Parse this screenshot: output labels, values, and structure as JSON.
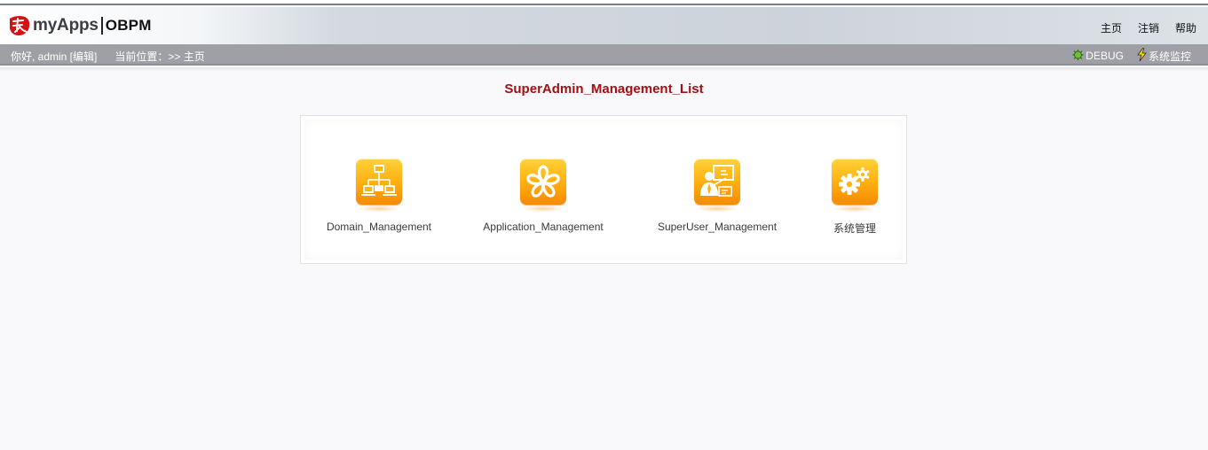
{
  "header": {
    "brand": "myApps",
    "product": "OBPM",
    "nav": [
      "主页",
      "注销",
      "帮助"
    ]
  },
  "bar": {
    "greeting": "你好, admin [编辑]",
    "location": "当前位置：>> 主页",
    "debug": "DEBUG",
    "monitor": "系统监控"
  },
  "main": {
    "title": "SuperAdmin_Management_List",
    "tiles": [
      {
        "label": "Domain_Management",
        "icon": "network-icon"
      },
      {
        "label": "Application_Management",
        "icon": "flower-icon"
      },
      {
        "label": "SuperUser_Management",
        "icon": "presenter-icon"
      },
      {
        "label": "系统管理",
        "icon": "gears-icon"
      }
    ]
  },
  "colors": {
    "title": "#a30f12",
    "bar": "#9ea0a5",
    "icon_orange": "#ffb414"
  }
}
